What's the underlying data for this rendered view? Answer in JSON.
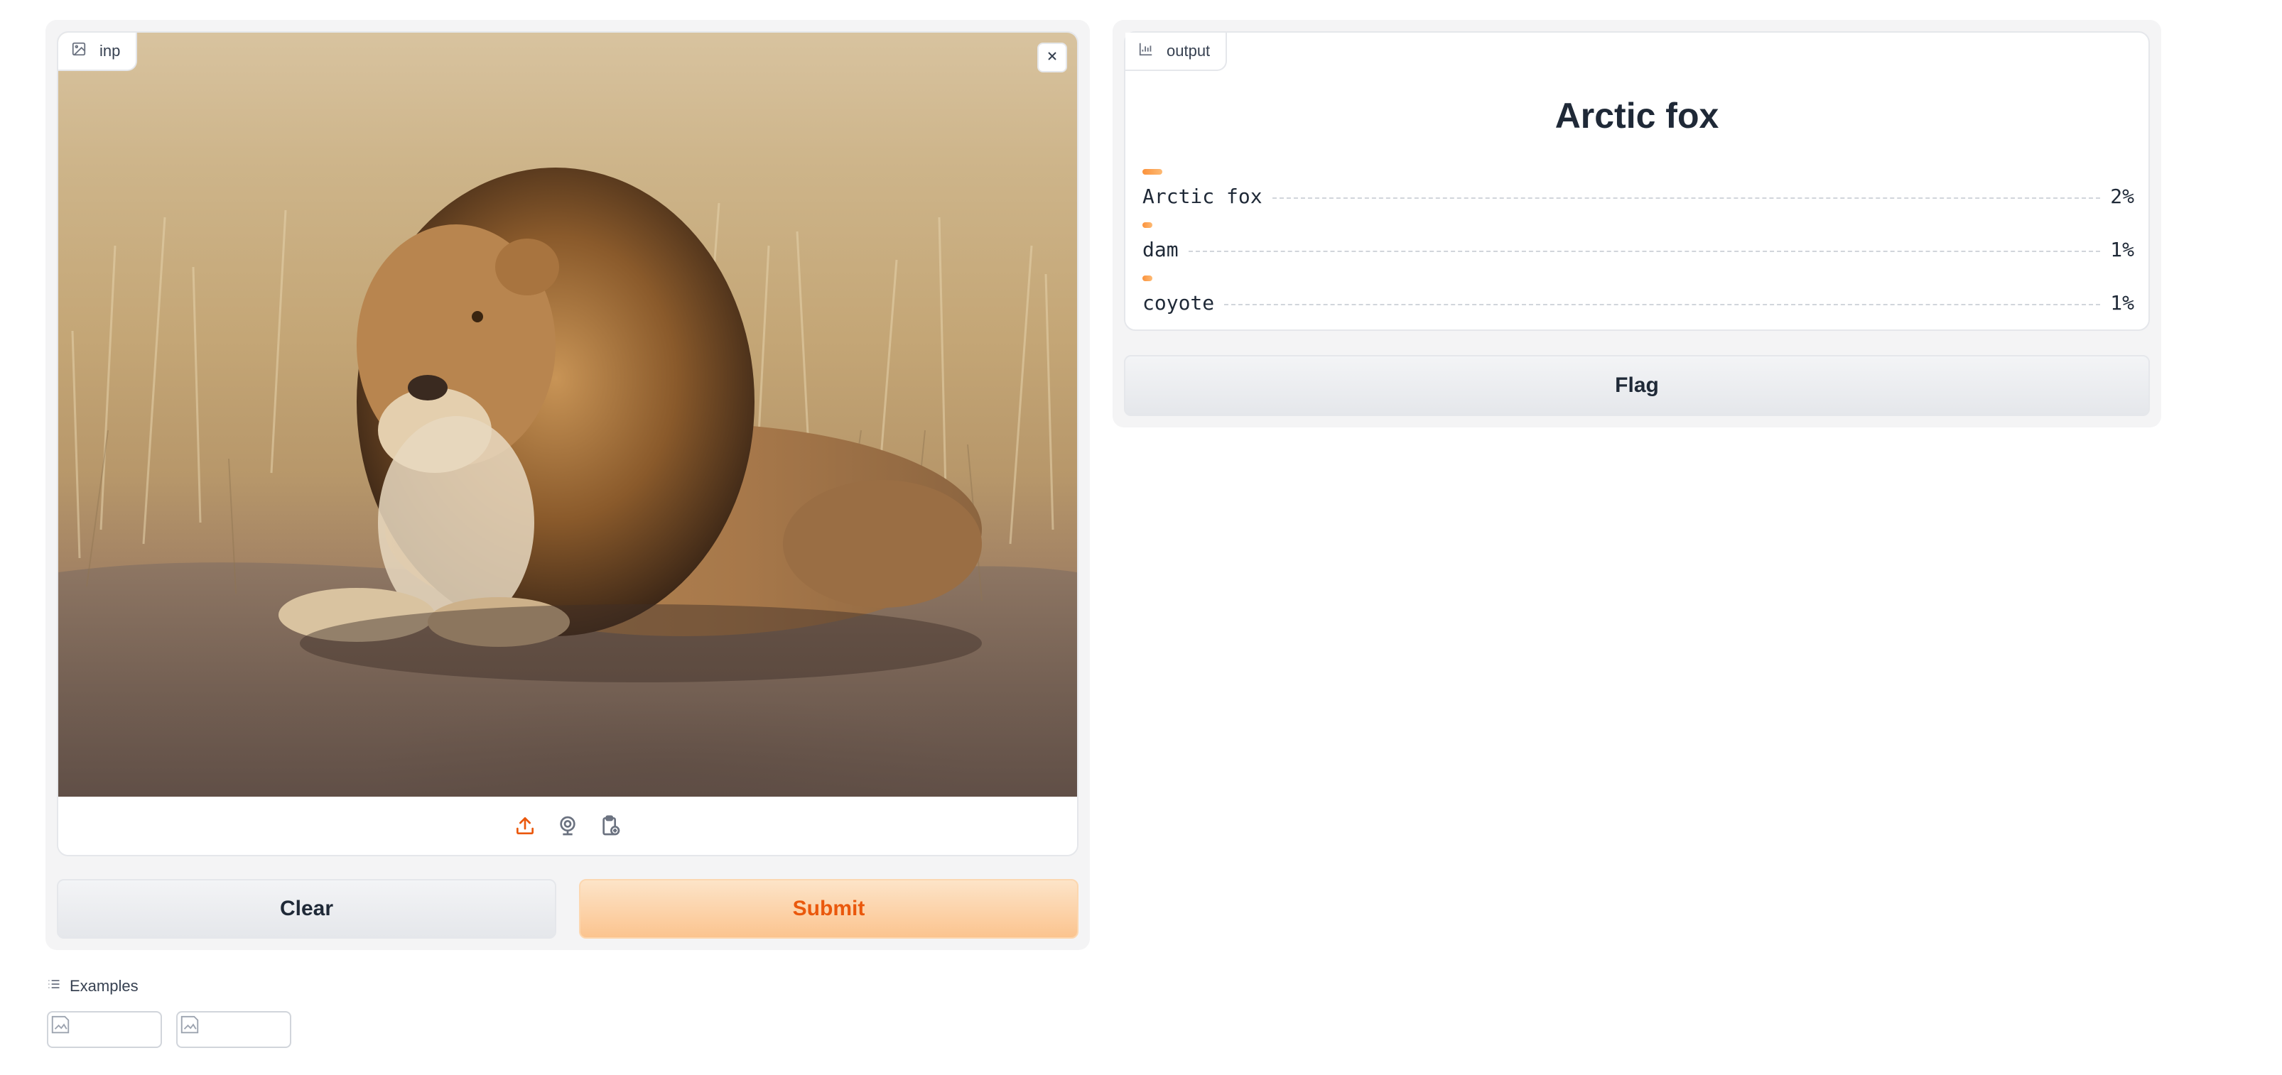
{
  "input": {
    "label": "inp"
  },
  "output": {
    "label": "output",
    "top_label": "Arctic fox",
    "confidences": [
      {
        "label": "Arctic fox",
        "value_text": "2%",
        "value": 0.02
      },
      {
        "label": "dam",
        "value_text": "1%",
        "value": 0.01
      },
      {
        "label": "coyote",
        "value_text": "1%",
        "value": 0.01
      }
    ]
  },
  "buttons": {
    "clear": "Clear",
    "submit": "Submit",
    "flag": "Flag"
  },
  "examples": {
    "title": "Examples",
    "count": 2
  },
  "icons": {
    "input_label": "image-icon",
    "output_label": "bar-chart-icon",
    "close": "close-icon",
    "upload": "upload-icon",
    "webcam": "webcam-icon",
    "clipboard": "clipboard-icon",
    "examples": "list-icon"
  },
  "colors": {
    "accent": "#ea580c",
    "confidence_bar": "#fb923c",
    "panel_bg": "#f4f4f5"
  }
}
